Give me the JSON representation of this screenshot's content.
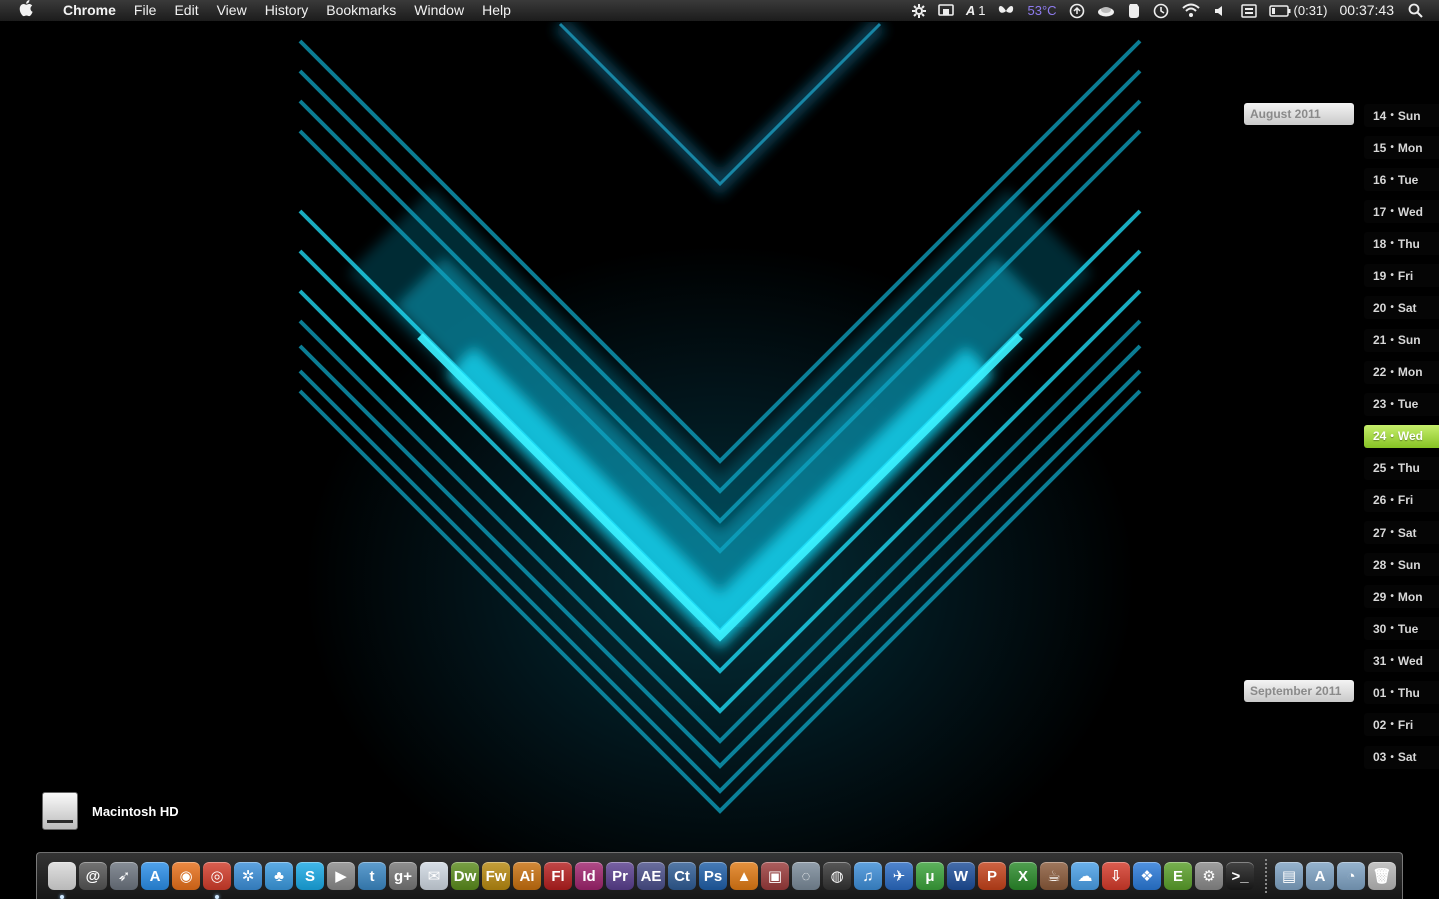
{
  "menubar": {
    "apple_glyph": "",
    "app_name": "Chrome",
    "items": [
      "File",
      "Edit",
      "View",
      "History",
      "Bookmarks",
      "Window",
      "Help"
    ],
    "status": {
      "workspace": "1",
      "temperature": "53°C",
      "battery": "(0:31)",
      "clock": "00:37:43"
    },
    "temperature_color": "#8f7cf0"
  },
  "calendar": {
    "months": [
      {
        "label": "August 2011"
      },
      {
        "label": "September 2011"
      }
    ],
    "days": [
      {
        "num": "14",
        "name": "Sun"
      },
      {
        "num": "15",
        "name": "Mon"
      },
      {
        "num": "16",
        "name": "Tue"
      },
      {
        "num": "17",
        "name": "Wed"
      },
      {
        "num": "18",
        "name": "Thu"
      },
      {
        "num": "19",
        "name": "Fri"
      },
      {
        "num": "20",
        "name": "Sat"
      },
      {
        "num": "21",
        "name": "Sun"
      },
      {
        "num": "22",
        "name": "Mon"
      },
      {
        "num": "23",
        "name": "Tue"
      },
      {
        "num": "24",
        "name": "Wed",
        "today": true
      },
      {
        "num": "25",
        "name": "Thu"
      },
      {
        "num": "26",
        "name": "Fri"
      },
      {
        "num": "27",
        "name": "Sat"
      },
      {
        "num": "28",
        "name": "Sun"
      },
      {
        "num": "29",
        "name": "Mon"
      },
      {
        "num": "30",
        "name": "Tue"
      },
      {
        "num": "31",
        "name": "Wed"
      },
      {
        "num": "01",
        "name": "Thu"
      },
      {
        "num": "02",
        "name": "Fri"
      },
      {
        "num": "03",
        "name": "Sat"
      }
    ],
    "today_color": "#9bd23a"
  },
  "desktop": {
    "drive_label": "Macintosh HD"
  },
  "dock": {
    "apps": [
      {
        "name": "finder-icon",
        "text": "",
        "bg": "#d9d9d9",
        "running": true
      },
      {
        "name": "mail-at-icon",
        "text": "@",
        "bg": "#555555"
      },
      {
        "name": "launchpad-icon",
        "text": "➶",
        "bg": "#6d7580"
      },
      {
        "name": "app-store-icon",
        "text": "A",
        "bg": "#2a8ee8"
      },
      {
        "name": "firefox-icon",
        "text": "◉",
        "bg": "#e8701a"
      },
      {
        "name": "chrome-icon",
        "text": "◎",
        "bg": "#d23c2a",
        "running": true
      },
      {
        "name": "safari-icon",
        "text": "✲",
        "bg": "#3b8fd9"
      },
      {
        "name": "messenger-icon",
        "text": "♣",
        "bg": "#3a9ae0"
      },
      {
        "name": "skype-icon",
        "text": "S",
        "bg": "#19a9e5"
      },
      {
        "name": "facetime-icon",
        "text": "▶",
        "bg": "#8a8a8a"
      },
      {
        "name": "twitter-icon",
        "text": "t",
        "bg": "#3b88c4"
      },
      {
        "name": "google-icon",
        "text": "g+",
        "bg": "#777777"
      },
      {
        "name": "mail-icon",
        "text": "✉",
        "bg": "#cfd8e2"
      },
      {
        "name": "dreamweaver-icon",
        "text": "Dw",
        "bg": "#5b8c1d"
      },
      {
        "name": "fireworks-icon",
        "text": "Fw",
        "bg": "#b88a10"
      },
      {
        "name": "illustrator-icon",
        "text": "Ai",
        "bg": "#c8700e"
      },
      {
        "name": "flash-icon",
        "text": "Fl",
        "bg": "#b51f1f"
      },
      {
        "name": "indesign-icon",
        "text": "Id",
        "bg": "#a0246e"
      },
      {
        "name": "premiere-icon",
        "text": "Pr",
        "bg": "#5a3f8f"
      },
      {
        "name": "after-effects-icon",
        "text": "AE",
        "bg": "#4a4f8a"
      },
      {
        "name": "captivate-icon",
        "text": "Ct",
        "bg": "#2f5c94"
      },
      {
        "name": "photoshop-icon",
        "text": "Ps",
        "bg": "#1f5fa8"
      },
      {
        "name": "vlc-icon",
        "text": "▲",
        "bg": "#e07a14"
      },
      {
        "name": "photo-booth-icon",
        "text": "▣",
        "bg": "#9a3b3b"
      },
      {
        "name": "preview-icon",
        "text": "◌",
        "bg": "#7a8a99"
      },
      {
        "name": "aperture-icon",
        "text": "◍",
        "bg": "#333333"
      },
      {
        "name": "itunes-icon",
        "text": "♫",
        "bg": "#3d8ed8"
      },
      {
        "name": "xcode-icon",
        "text": "✈",
        "bg": "#2a6bc4"
      },
      {
        "name": "utorrent-icon",
        "text": "μ",
        "bg": "#3aa23a"
      },
      {
        "name": "word-icon",
        "text": "W",
        "bg": "#1d4e9a"
      },
      {
        "name": "powerpoint-icon",
        "text": "P",
        "bg": "#c4421a"
      },
      {
        "name": "excel-icon",
        "text": "X",
        "bg": "#2a8a2a"
      },
      {
        "name": "coffee-icon",
        "text": "☕",
        "bg": "#8a5a3a"
      },
      {
        "name": "cloud-icon",
        "text": "☁",
        "bg": "#4aa0e8"
      },
      {
        "name": "inbox-icon",
        "text": "⇩",
        "bg": "#d43a2a"
      },
      {
        "name": "dropbox-icon",
        "text": "❖",
        "bg": "#2a7ad9"
      },
      {
        "name": "evernote-icon",
        "text": "E",
        "bg": "#5aa02a"
      },
      {
        "name": "system-preferences-icon",
        "text": "⚙",
        "bg": "#8a8a8a"
      },
      {
        "name": "terminal-icon",
        "text": ">_",
        "bg": "#1a1a1a"
      }
    ],
    "folders": [
      {
        "name": "documents-folder-icon",
        "text": "▤",
        "bg": "#7fa3c4"
      },
      {
        "name": "applications-folder-icon",
        "text": "A",
        "bg": "#7fa3c4"
      },
      {
        "name": "downloads-folder-icon",
        "text": "◔",
        "bg": "#7fa3c4"
      },
      {
        "name": "trash-icon",
        "text": "🗑",
        "bg": "#b8b8b8"
      }
    ]
  }
}
